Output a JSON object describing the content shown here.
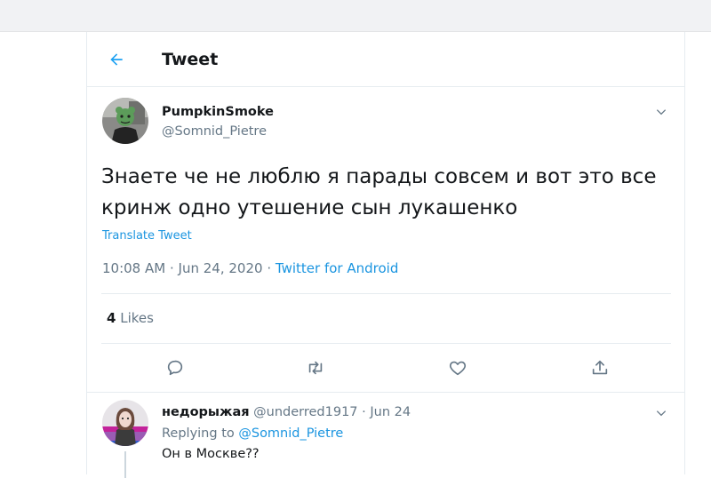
{
  "header": {
    "title": "Tweet",
    "back_icon": "arrow-left-icon"
  },
  "tweet": {
    "author_name": "PumpkinSmoke",
    "author_handle": "@Somnid_Pietre",
    "text_line1": "Знаете че не люблю я парады совсем и вот это все",
    "text_line2": "кринж одно утешение сын лукашенко",
    "translate_label": "Translate Tweet",
    "time": "10:08 AM",
    "date": "Jun 24, 2020",
    "separator": "·",
    "source": "Twitter for Android",
    "likes_count": "4",
    "likes_label": "Likes"
  },
  "actions": [
    "reply-icon",
    "retweet-icon",
    "like-icon",
    "share-icon"
  ],
  "reply": {
    "name": "недорыжая",
    "handle": "@underred1917",
    "separator": "·",
    "date": "Jun 24",
    "replying_prefix": "Replying to",
    "replying_to": "@Somnid_Pietre",
    "text": "Он в Москве??"
  },
  "colors": {
    "accent": "#1da1f2",
    "link": "#1b95e0",
    "secondary_text": "#657786",
    "border": "#e6ecf0"
  }
}
